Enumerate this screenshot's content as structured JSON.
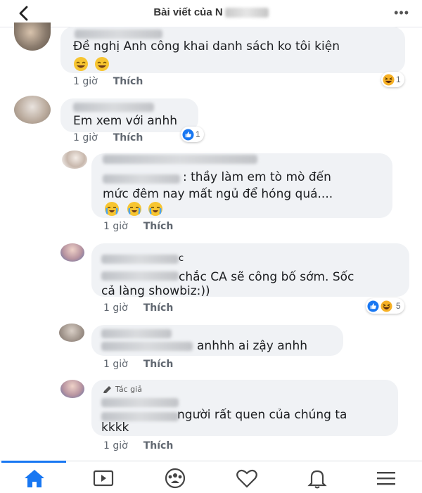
{
  "header": {
    "title": "Bài viết của N",
    "back_icon": "chevron-left-icon",
    "more_icon": "ellipsis-icon",
    "more_label": "•••"
  },
  "comments": [
    {
      "text_lines": [
        "Đề nghị Anh công khai danh sách ko tôi kiện"
      ],
      "time": "1 giờ",
      "like_label": "Thích",
      "reaction_icons": [
        "haha-icon"
      ],
      "reaction_count": "1",
      "emojis": [
        "grinning-emoji",
        "grinning-emoji"
      ]
    },
    {
      "text_lines": [
        "Em xem với anhh"
      ],
      "time": "1 giờ",
      "like_label": "Thích",
      "reaction_icons": [
        "like-icon"
      ],
      "reaction_count": "1"
    },
    {
      "text_lines": [
        ": thầy làm em tò mò đến",
        "mức đêm nay mất ngủ để hóng quá...."
      ],
      "time": "1 giờ",
      "like_label": "Thích",
      "emojis": [
        "crying-emoji",
        "crying-emoji",
        "crying-emoji"
      ]
    },
    {
      "author_partial": "c",
      "text_lines": [
        "chắc CA sẽ công bố sớm. Sốc",
        "cả làng showbiz:))"
      ],
      "time": "1 giờ",
      "like_label": "Thích",
      "reaction_icons": [
        "like-icon",
        "haha-icon"
      ],
      "reaction_count": "5"
    },
    {
      "text_lines": [
        "anhhh ai zậy anhh"
      ],
      "time": "1 giờ",
      "like_label": "Thích"
    },
    {
      "author_tag": "Tác giả",
      "text_lines": [
        "người rất quen của chúng ta",
        "kkkk"
      ],
      "time": "1 giờ",
      "like_label": "Thích"
    }
  ],
  "bottom_nav": [
    {
      "icon": "home-icon",
      "active": true
    },
    {
      "icon": "watch-video-icon",
      "active": false
    },
    {
      "icon": "groups-icon",
      "active": false
    },
    {
      "icon": "dating-heart-icon",
      "active": false
    },
    {
      "icon": "notifications-bell-icon",
      "active": false
    },
    {
      "icon": "menu-icon",
      "active": false
    }
  ],
  "colors": {
    "accent": "#1877f2",
    "bubble": "#f0f2f5",
    "meta_text": "#606770"
  }
}
